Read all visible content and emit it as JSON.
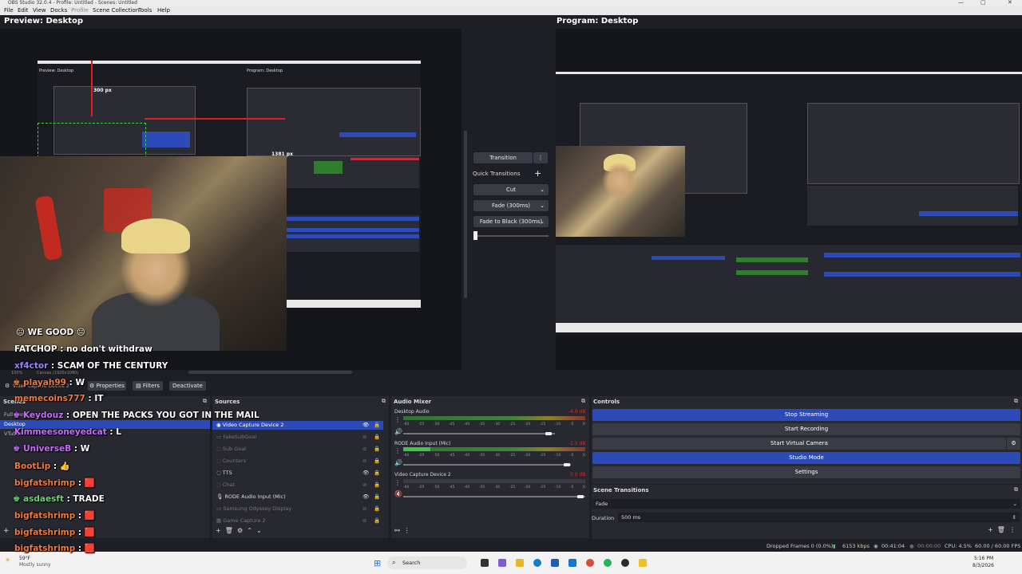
{
  "window": {
    "title": "OBS Studio 32.0.4 - Profile: Untitled - Scenes: Untitled"
  },
  "menu": [
    "File",
    "Edit",
    "View",
    "Docks",
    "Profile",
    "Scene Collection",
    "Tools",
    "Help"
  ],
  "preview": {
    "title": "Preview: Desktop",
    "measure_top": "300 px",
    "measure_right": "1381 px",
    "nested_preview_label": "Preview: Desktop",
    "nested_program_label": "Program: Desktop"
  },
  "program": {
    "title": "Program: Desktop"
  },
  "transition_panel": {
    "transition_btn": "Transition",
    "menu_dots": "⋮",
    "quick_transitions": "Quick Transitions",
    "add": "+",
    "items": [
      "Cut",
      "Fade (300ms)",
      "Fade to Black (300ms)"
    ]
  },
  "source_toolbar": {
    "selected": "Video Capture Device 2",
    "properties": "Properties",
    "filters": "Filters",
    "deactivate": "Deactivate",
    "canvas": "Canvas (1920x1080)",
    "zoom": "100%"
  },
  "scenes": {
    "title": "Scenes",
    "items": [
      "Full Cam",
      "Desktop",
      "VTuber"
    ],
    "selected_index": 1
  },
  "sources": {
    "title": "Sources",
    "items": [
      {
        "name": "Video Capture Device 2",
        "visible": true,
        "selected": true
      },
      {
        "name": "FakeSubGoal",
        "visible": false,
        "selected": false
      },
      {
        "name": "Sub Goal",
        "visible": false,
        "selected": false
      },
      {
        "name": "Counters",
        "visible": false,
        "selected": false
      },
      {
        "name": "TTS",
        "visible": true,
        "selected": false
      },
      {
        "name": "Chat",
        "visible": false,
        "selected": false
      },
      {
        "name": "RODE Audio Input (Mic)",
        "visible": true,
        "selected": false
      },
      {
        "name": "Samsung Odyssey Display",
        "visible": false,
        "selected": false
      },
      {
        "name": "Game Capture 2",
        "visible": false,
        "selected": false
      }
    ]
  },
  "audio": {
    "title": "Audio Mixer",
    "channels": [
      {
        "name": "Desktop Audio",
        "db": "-4.0 dB",
        "level": 0.92,
        "active": false
      },
      {
        "name": "RODE Audio Input (Mic)",
        "db": "-1.5 dB",
        "level": 0.85,
        "active": true
      },
      {
        "name": "Video Capture Device 2",
        "db": "0.0 dB",
        "level": 0.97,
        "active": false
      }
    ],
    "scale": [
      "-60",
      "-55",
      "-50",
      "-45",
      "-40",
      "-35",
      "-30",
      "-25",
      "-20",
      "-15",
      "-10",
      "-5",
      "0"
    ]
  },
  "controls": {
    "title": "Controls",
    "buttons": [
      {
        "label": "Stop Streaming",
        "active": true
      },
      {
        "label": "Start Recording",
        "active": false
      },
      {
        "label": "Start Virtual Camera",
        "active": false
      },
      {
        "label": "Studio Mode",
        "active": true
      },
      {
        "label": "Settings",
        "active": false
      }
    ]
  },
  "scene_transitions": {
    "title": "Scene Transitions",
    "transition": "Fade",
    "duration_label": "Duration",
    "duration_value": "500 ms"
  },
  "status": {
    "dropped": "Dropped Frames 0 (0.0%)",
    "kbps": "6153 kbps",
    "live_time": "00:41:04",
    "rec_time": "00:00:00",
    "cpu": "CPU: 4.5%",
    "fps": "60.00 / 60.00 FPS"
  },
  "chat": [
    {
      "user": "",
      "text": "WE GOOD",
      "color": "#ffffff"
    },
    {
      "user": "FATCHOP",
      "text": ": no don't withdraw",
      "color": "#ffffff"
    },
    {
      "user": "xf4ctor",
      "text": ": SCAM OF THE CENTURY",
      "color": "#9a80ff"
    },
    {
      "user": "playah99",
      "text": ": W",
      "color": "#f07a3a"
    },
    {
      "user": "memecoins777",
      "text": ": IT",
      "color": "#f07a3a"
    },
    {
      "user": "Keydouz",
      "text": ": OPEN THE PACKS YOU GOT IN THE MAIL",
      "color": "#c76bff"
    },
    {
      "user": "Kimmeesoneyedcat",
      "text": ": L",
      "color": "#c76bff"
    },
    {
      "user": "UniverseB",
      "text": ": W",
      "color": "#c76bff"
    },
    {
      "user": "BootLip",
      "text": ":",
      "color": "#f07a3a"
    },
    {
      "user": "bigfatshrimp",
      "text": ":",
      "color": "#f07a3a"
    },
    {
      "user": "asdaesft",
      "text": ": TRADE",
      "color": "#6fd36f"
    },
    {
      "user": "bigfatshrimp",
      "text": ":",
      "color": "#f07a3a"
    },
    {
      "user": "bigfatshrimp",
      "text": ":",
      "color": "#f07a3a"
    },
    {
      "user": "bigfatshrimp",
      "text": ":",
      "color": "#f07a3a"
    }
  ],
  "taskbar": {
    "weather_temp": "59°F",
    "weather_desc": "Mostly sunny",
    "search": "Search",
    "time": "5:16 PM",
    "date": "8/3/2026"
  },
  "colors": {
    "accent": "#2d4bb8",
    "bg": "#1e1f24",
    "dock": "#272830"
  }
}
